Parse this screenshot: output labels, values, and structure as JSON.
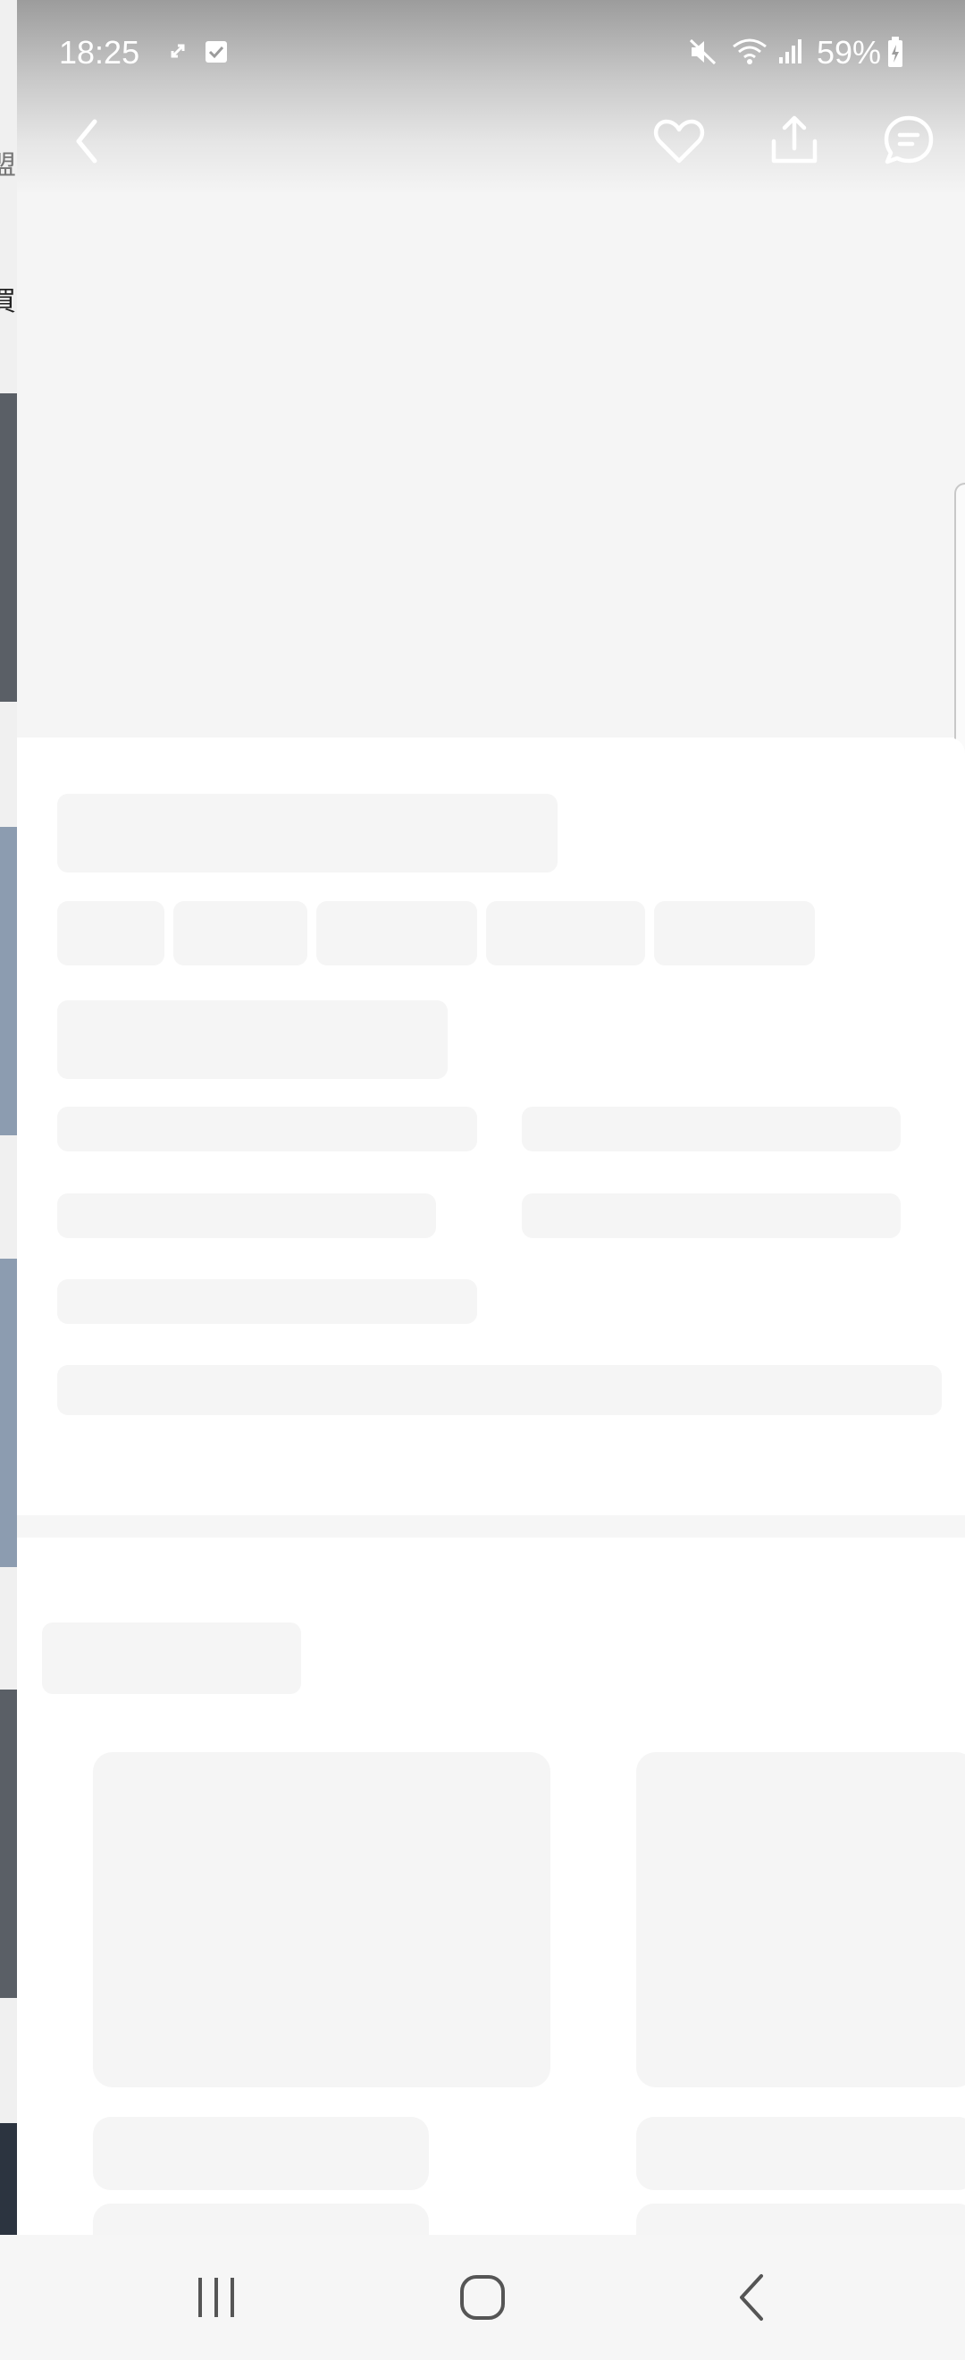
{
  "status_bar": {
    "time": "18:25",
    "battery": "59%",
    "icons": [
      "sync-icon",
      "task-check-icon",
      "mute-icon",
      "wifi-icon",
      "signal-icon",
      "battery-icon"
    ]
  },
  "toolbar": {
    "icons": [
      "back-arrow-icon",
      "heart-icon",
      "share-icon",
      "chat-icon"
    ]
  },
  "left_strip": {
    "chars": [
      "盟",
      "買"
    ]
  },
  "nav_bar": {
    "icons": [
      "recent-apps-icon",
      "home-icon",
      "back-icon"
    ]
  },
  "colors": {
    "skeleton": "#f5f5f5",
    "status_text": "#ffffff"
  }
}
